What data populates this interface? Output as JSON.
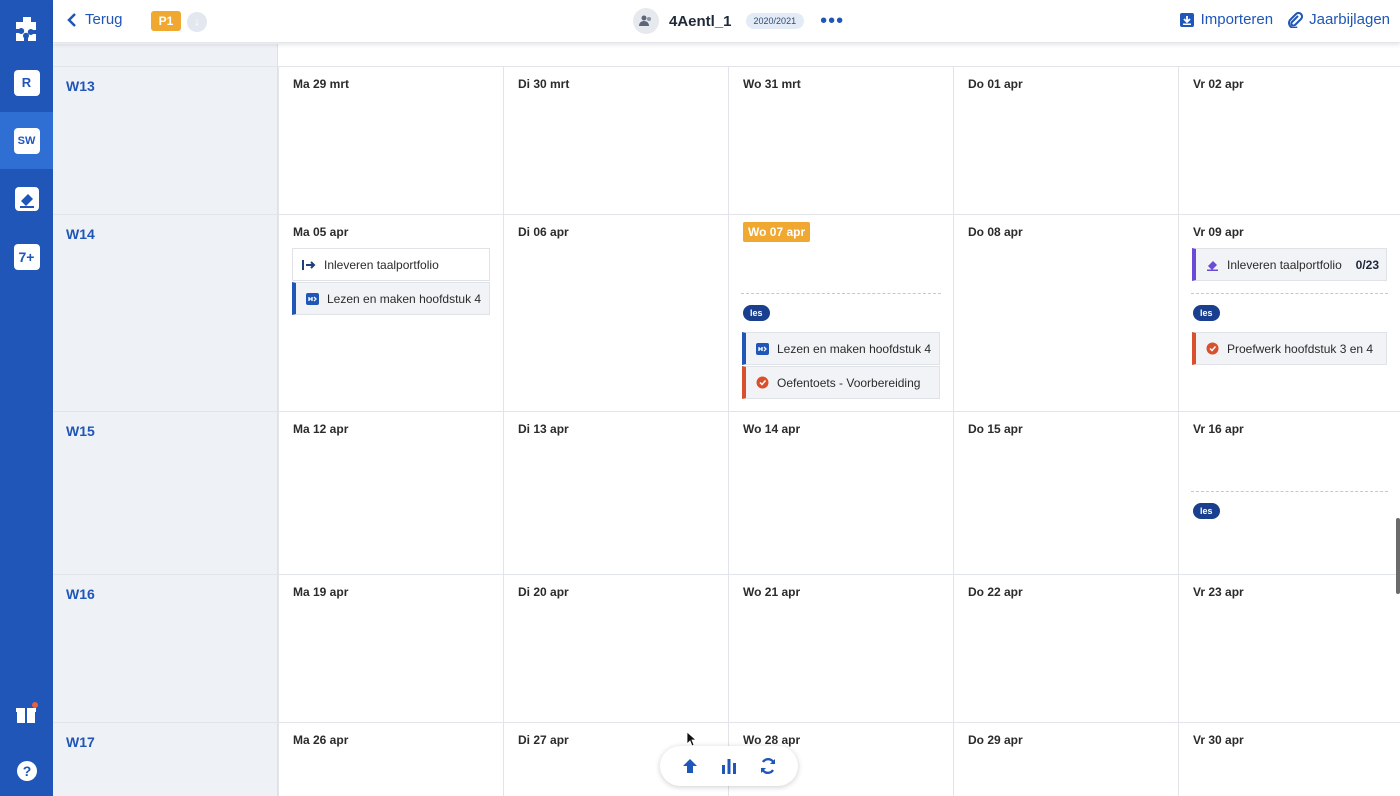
{
  "rail": {
    "items": [
      {
        "name": "rail-logo",
        "glyph": ""
      },
      {
        "name": "rail-item-r",
        "glyph": "R"
      },
      {
        "name": "rail-item-sw",
        "glyph": "SW"
      },
      {
        "name": "rail-item-tasks",
        "glyph": ""
      },
      {
        "name": "rail-item-7plus",
        "glyph": "7+"
      }
    ]
  },
  "header": {
    "back_label": "Terug",
    "period": "P1",
    "group_name": "4Aentl_1",
    "year": "2020/2021",
    "more": "•••",
    "import_label": "Importeren",
    "attachments_label": "Jaarbijlagen"
  },
  "weeks": [
    {
      "label": "W13",
      "days": [
        "Ma 29 mrt",
        "Di 30 mrt",
        "Wo 31 mrt",
        "Do 01 apr",
        "Vr 02 apr"
      ]
    },
    {
      "label": "W14",
      "days": [
        "Ma 05 apr",
        "Di 06 apr",
        "Wo 07 apr",
        "Do 08 apr",
        "Vr 09 apr"
      ]
    },
    {
      "label": "W15",
      "days": [
        "Ma 12 apr",
        "Di 13 apr",
        "Wo 14 apr",
        "Do 15 apr",
        "Vr 16 apr"
      ]
    },
    {
      "label": "W16",
      "days": [
        "Ma 19 apr",
        "Di 20 apr",
        "Wo 21 apr",
        "Do 22 apr",
        "Vr 23 apr"
      ]
    },
    {
      "label": "W17",
      "days": [
        "Ma 26 apr",
        "Di 27 apr",
        "Wo 28 apr",
        "Do 29 apr",
        "Vr 30 apr"
      ]
    }
  ],
  "items": {
    "mon05_a": "Inleveren taalportfolio",
    "mon05_b": "Lezen en maken hoofdstuk 4",
    "wed07_les": "les",
    "wed07_a": "Lezen en maken hoofdstuk 4",
    "wed07_b": "Oefentoets - Voorbereiding",
    "fri09_a": "Inleveren taalportfolio",
    "fri09_a_count": "0/23",
    "fri09_les": "les",
    "fri09_b": "Proefwerk hoofdstuk 3 en 4",
    "fri16_les": "les"
  },
  "colors": {
    "brand": "#1f56b8",
    "today": "#f0a830",
    "les_pill": "#1a3f8f",
    "accent_red": "#d9502c",
    "accent_purple": "#6a4bd6"
  }
}
